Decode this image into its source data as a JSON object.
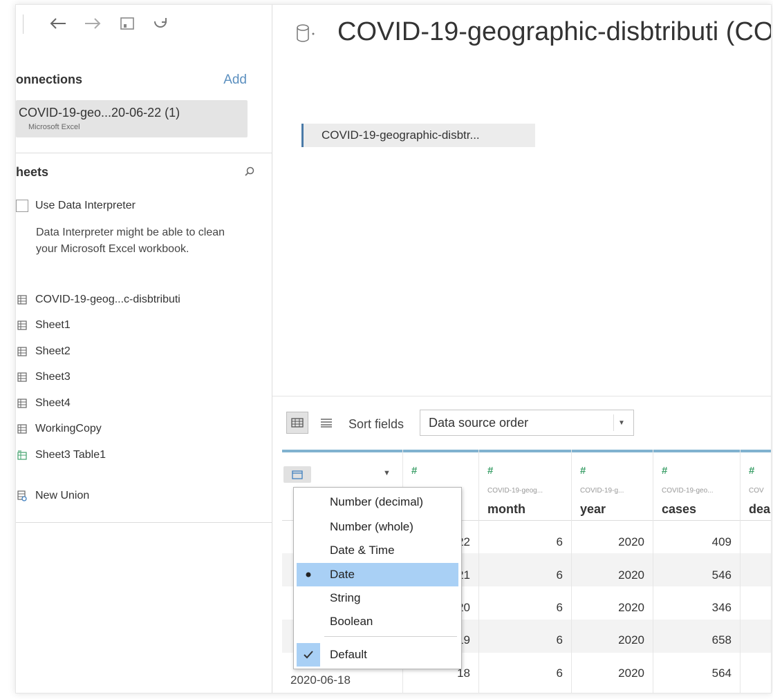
{
  "toolbar": {
    "icons": [
      "back-arrow-icon",
      "forward-arrow-icon",
      "save-icon",
      "refresh-icon"
    ]
  },
  "connections": {
    "title": "onnections",
    "add_label": "Add",
    "item_name": "COVID-19-geo...20-06-22 (1)",
    "item_type": "Microsoft Excel"
  },
  "sheets": {
    "title": "heets",
    "interpreter_label": "Use Data Interpreter",
    "interpreter_description": "Data Interpreter might be able to clean your Microsoft Excel workbook.",
    "items": [
      {
        "label": "COVID-19-geog...c-disbtributi",
        "icon": "table-icon"
      },
      {
        "label": "Sheet1",
        "icon": "table-icon"
      },
      {
        "label": "Sheet2",
        "icon": "table-icon"
      },
      {
        "label": "Sheet3",
        "icon": "table-icon"
      },
      {
        "label": "Sheet4",
        "icon": "table-icon"
      },
      {
        "label": "WorkingCopy",
        "icon": "table-icon"
      },
      {
        "label": "Sheet3 Table1",
        "icon": "named-range-icon"
      },
      {
        "label": "New Union",
        "icon": "union-icon"
      }
    ]
  },
  "datasource": {
    "title": "COVID-19-geographic-disbtributi (CO",
    "canvas_table": "COVID-19-geographic-disbtr..."
  },
  "grid_toolbar": {
    "sort_label": "Sort fields",
    "sort_value": "Data source order"
  },
  "columns": [
    {
      "type_icon": "#",
      "source": "",
      "name": "",
      "values": [
        "22",
        "21",
        "20",
        "19",
        "18"
      ]
    },
    {
      "type_icon": "#",
      "source": "COVID-19-geog...",
      "name": "month",
      "values": [
        "6",
        "6",
        "6",
        "6",
        "6"
      ]
    },
    {
      "type_icon": "#",
      "source": "COVID-19-g...",
      "name": "year",
      "values": [
        "2020",
        "2020",
        "2020",
        "2020",
        "2020"
      ]
    },
    {
      "type_icon": "#",
      "source": "COVID-19-geo...",
      "name": "cases",
      "values": [
        "409",
        "546",
        "346",
        "658",
        "564"
      ]
    },
    {
      "type_icon": "#",
      "source": "COV",
      "name": "dea",
      "values": [
        "",
        "",
        "",
        "",
        ""
      ]
    }
  ],
  "date_column": {
    "partial_value": "2020-06-18"
  },
  "type_menu": {
    "items": [
      "Number (decimal)",
      "Number (whole)",
      "Date & Time",
      "Date",
      "String",
      "Boolean"
    ],
    "selected": "Date",
    "default_label": "Default"
  }
}
